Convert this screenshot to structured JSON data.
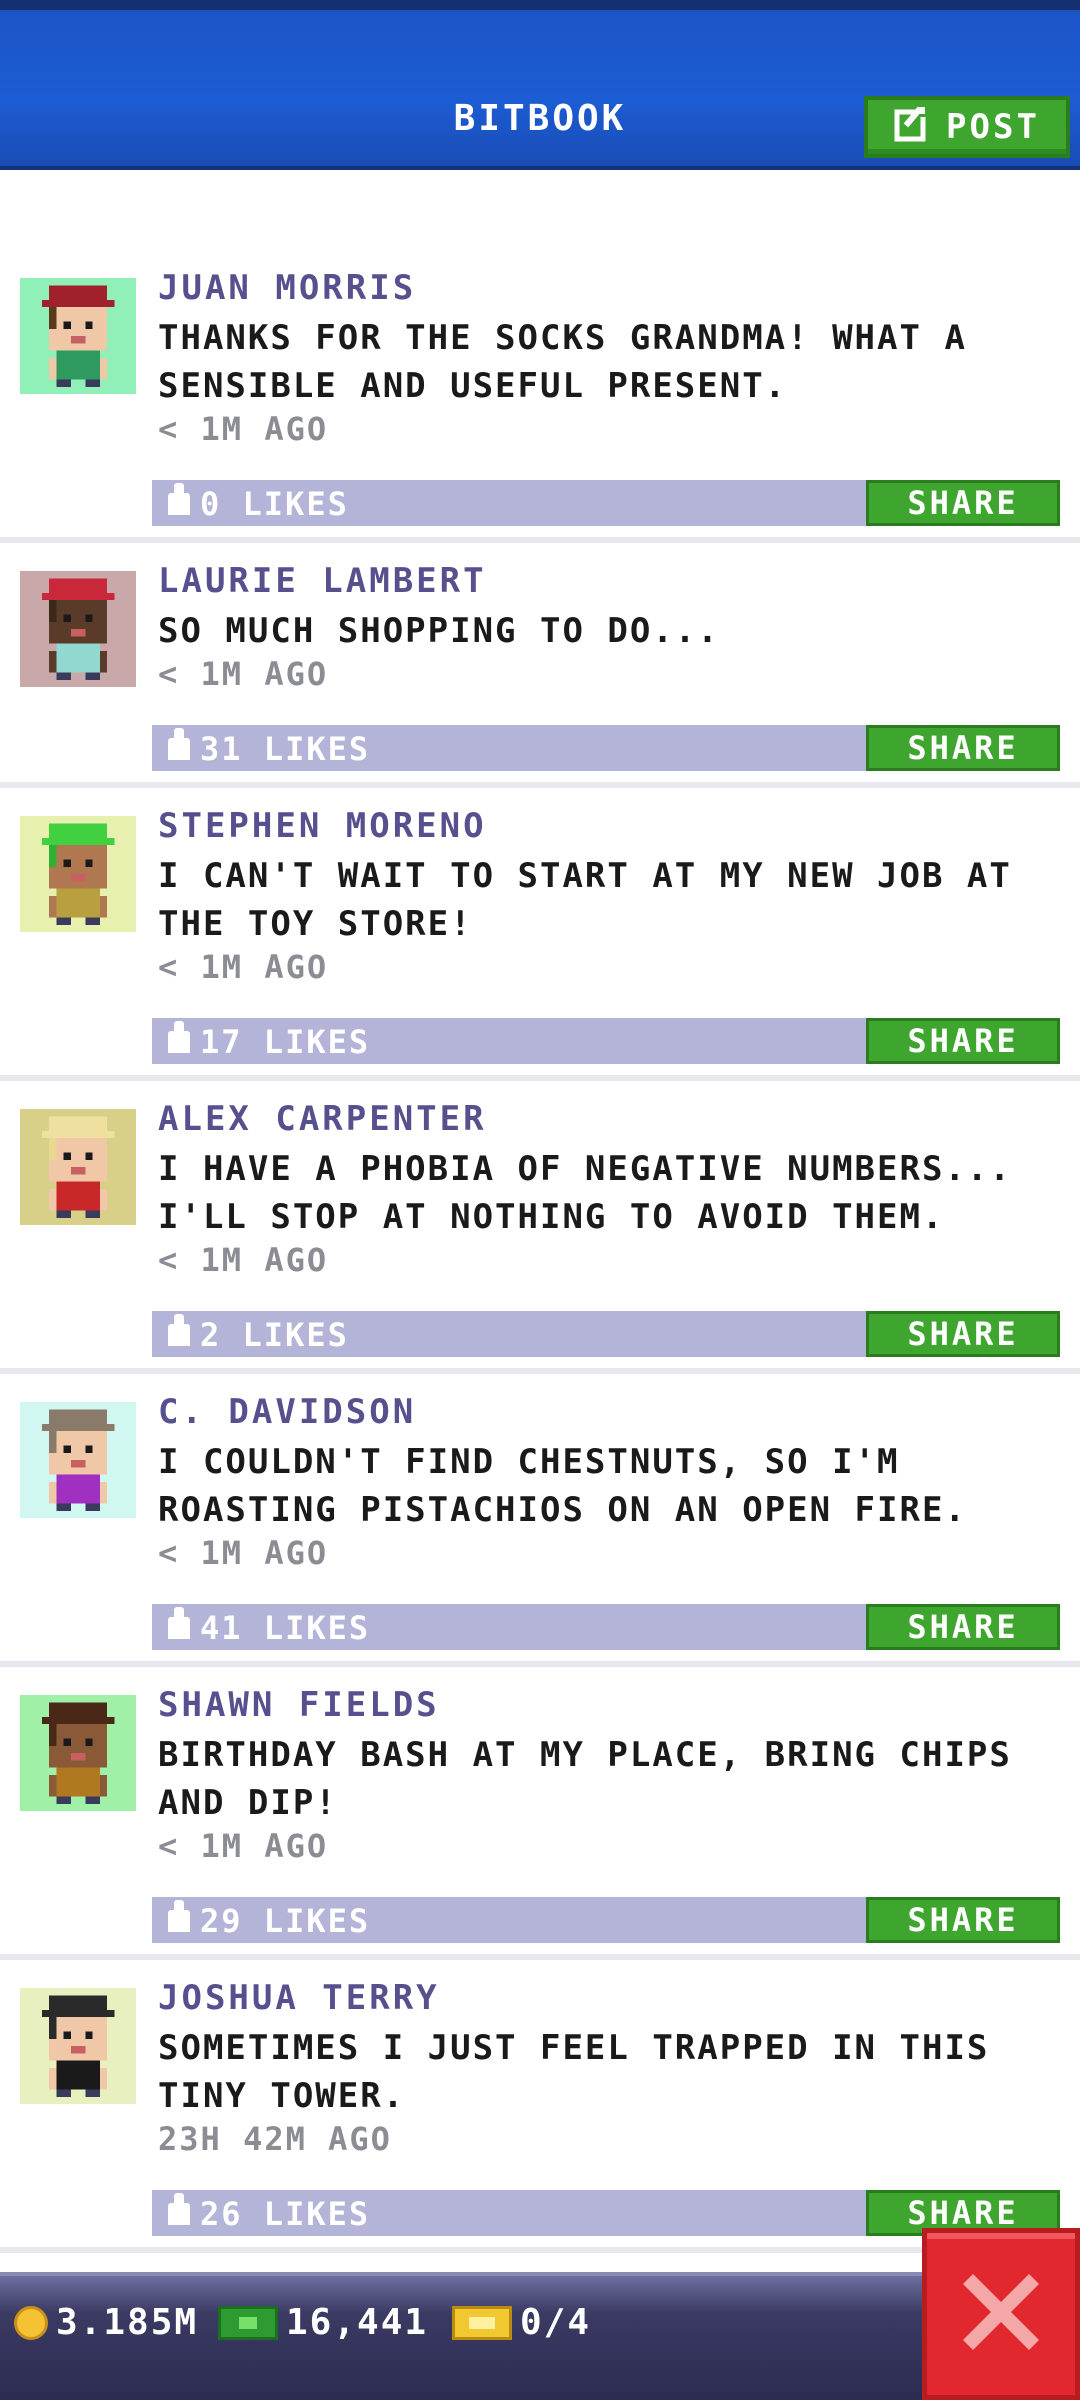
{
  "header": {
    "title": "BITBOOK",
    "post_label": "POST",
    "post_icon": "edit-icon",
    "colors": {
      "bar": "#1c5cd4",
      "button": "#3ea62e"
    }
  },
  "feed": {
    "posts": [
      {
        "author": "JUAN MORRIS",
        "message": "THANKS FOR THE SOCKS GRANDMA! WHAT A SENSIBLE AND USEFUL PRESENT.",
        "time": "< 1M AGO",
        "likes": "0 LIKES",
        "share": "SHARE",
        "avatar": {
          "bg": "#90f0b8",
          "hat": "#a0202c",
          "skin": "#f0c8a8",
          "shirt": "#2e9a60",
          "hair": "#5a3a1c"
        }
      },
      {
        "author": "LAURIE LAMBERT",
        "message": "SO MUCH SHOPPING TO DO...",
        "time": "< 1M AGO",
        "likes": "31 LIKES",
        "share": "SHARE",
        "avatar": {
          "bg": "#c8a8a8",
          "hat": "#c8283a",
          "skin": "#5a3a28",
          "shirt": "#90d8d0",
          "hair": "#3a2818"
        }
      },
      {
        "author": "STEPHEN MORENO",
        "message": "I CAN'T WAIT TO START AT MY NEW JOB AT THE TOY STORE!",
        "time": "< 1M AGO",
        "likes": "17 LIKES",
        "share": "SHARE",
        "avatar": {
          "bg": "#e8f0b0",
          "hat": "#40d040",
          "skin": "#b07850",
          "shirt": "#b8a040",
          "hair": "#30b030"
        }
      },
      {
        "author": "ALEX CARPENTER",
        "message": "I HAVE A PHOBIA OF NEGATIVE NUMBERS... I'LL STOP AT NOTHING TO AVOID THEM.",
        "time": "< 1M AGO",
        "likes": "2 LIKES",
        "share": "SHARE",
        "avatar": {
          "bg": "#d8d088",
          "hat": "#f0e0a0",
          "skin": "#f0c8a8",
          "shirt": "#c82828",
          "hair": "#e8d890"
        }
      },
      {
        "author": "C. DAVIDSON",
        "message": "I COULDN'T FIND CHESTNUTS, SO I'M ROASTING PISTACHIOS ON AN OPEN FIRE.",
        "time": "< 1M AGO",
        "likes": "41 LIKES",
        "share": "SHARE",
        "avatar": {
          "bg": "#d0f8f0",
          "hat": "#8a7a6a",
          "skin": "#f0c8a8",
          "shirt": "#a030c0",
          "hair": "#8a7a6a"
        }
      },
      {
        "author": "SHAWN FIELDS",
        "message": "BIRTHDAY BASH AT MY PLACE, BRING CHIPS AND DIP!",
        "time": "< 1M AGO",
        "likes": "29 LIKES",
        "share": "SHARE",
        "avatar": {
          "bg": "#a0f0a8",
          "hat": "#4a2818",
          "skin": "#8a5a38",
          "shirt": "#b07820",
          "hair": "#4a2818"
        }
      },
      {
        "author": "JOSHUA TERRY",
        "message": "SOMETIMES I JUST FEEL TRAPPED IN THIS TINY TOWER.",
        "time": "23H 42M AGO",
        "likes": "26 LIKES",
        "share": "SHARE",
        "avatar": {
          "bg": "#e8f0c0",
          "hat": "#2a2a2a",
          "skin": "#f0c8a8",
          "shirt": "#1a1a1a",
          "hair": "#2a2a2a"
        }
      }
    ]
  },
  "status": {
    "coins": "3.185M",
    "bux": "16,441",
    "tickets": "0/4",
    "coin_icon": "coin-icon",
    "bux_icon": "bux-icon",
    "ticket_icon": "ticket-icon"
  },
  "close": {
    "icon": "close-icon",
    "color": "#e0282e"
  }
}
